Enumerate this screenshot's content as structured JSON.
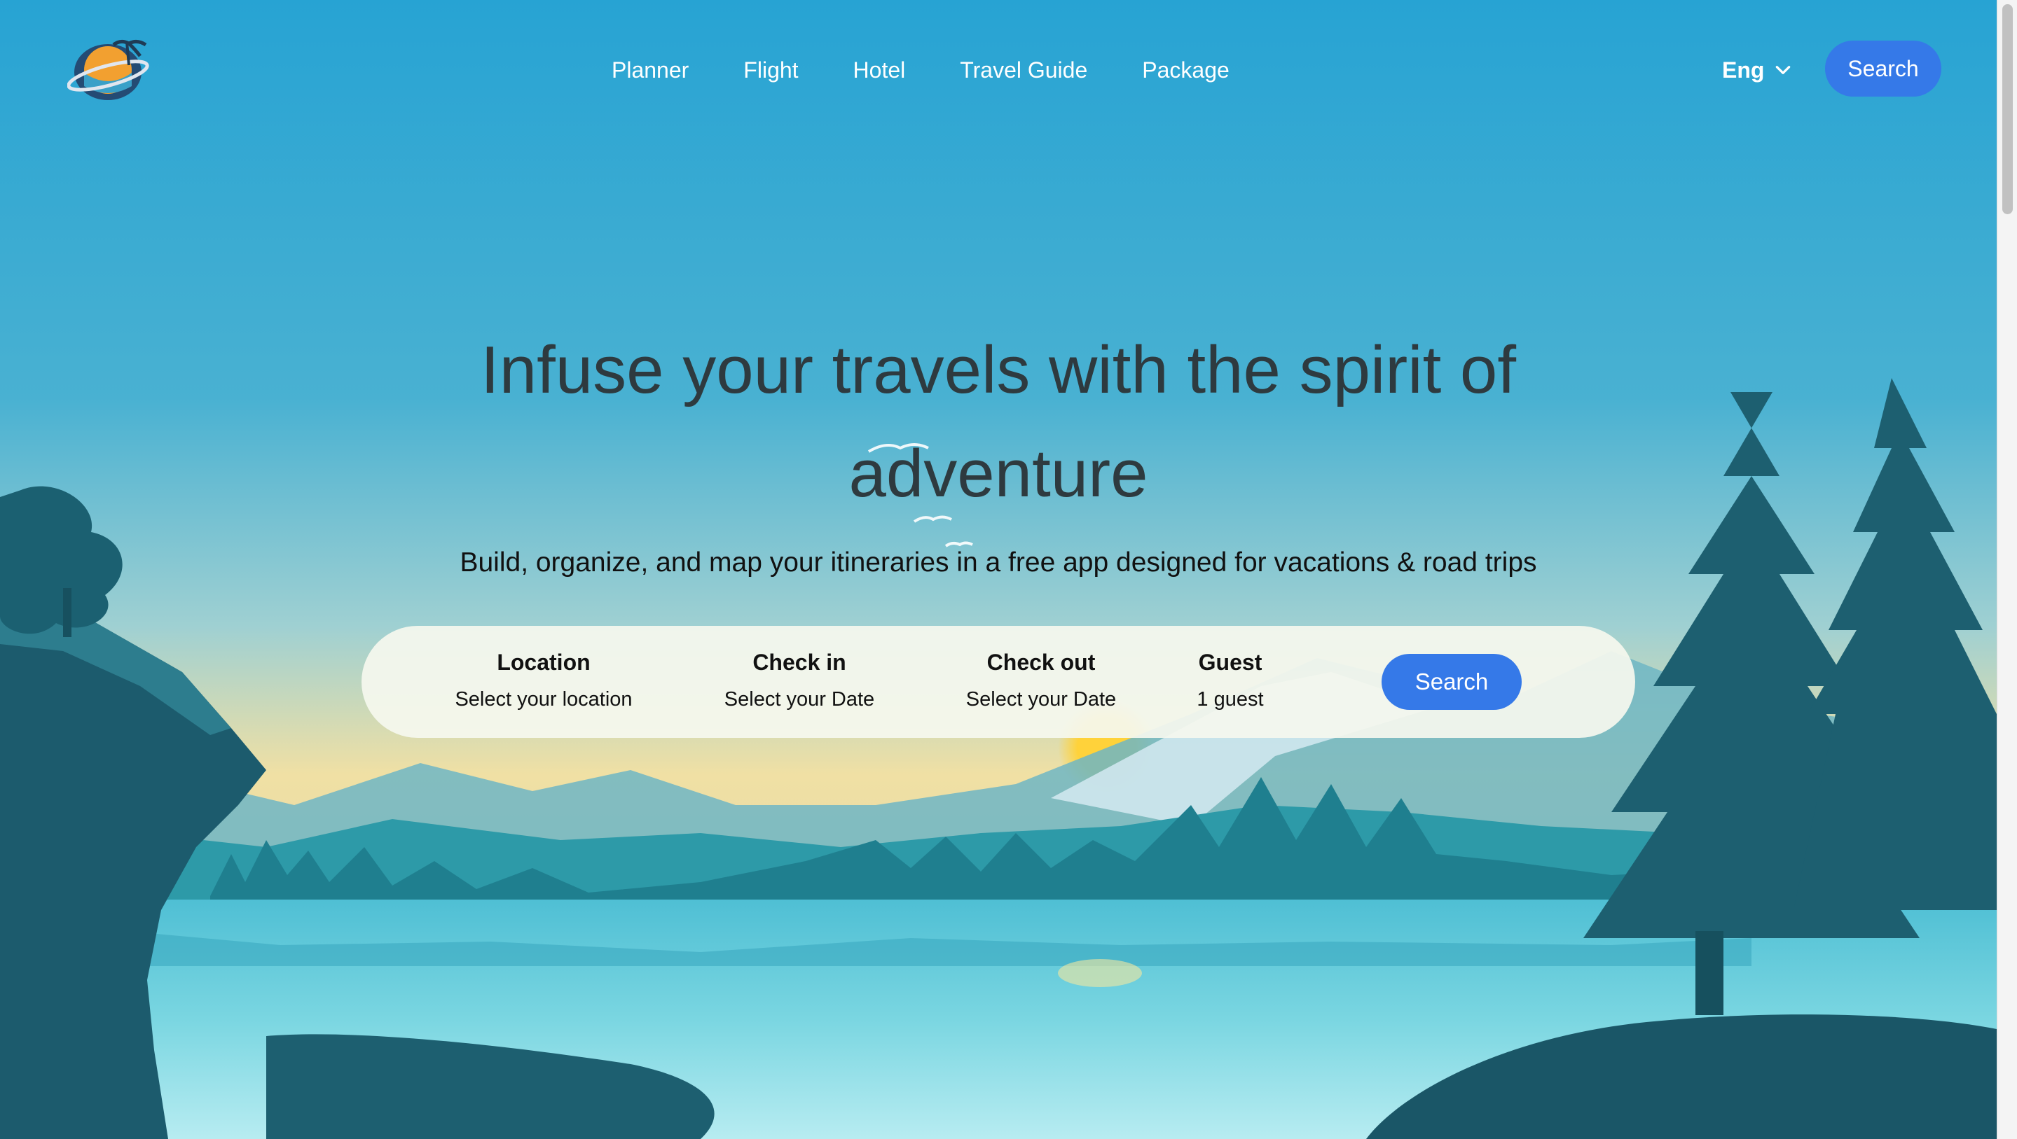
{
  "header": {
    "logo_icon": "palm-island-globe-logo",
    "nav": [
      "Planner",
      "Flight",
      "Hotel",
      "Travel Guide",
      "Package"
    ],
    "language": "Eng",
    "search_label": "Search"
  },
  "hero": {
    "title": "Infuse your travels with the spirit of adventure",
    "subtitle": "Build, organize, and map your itineraries in a free app designed for vacations & road trips"
  },
  "search_bar": {
    "location_label": "Location",
    "location_value": "Select your location",
    "checkin_label": "Check in",
    "checkin_value": "Select your Date",
    "checkout_label": "Check out",
    "checkout_value": "Select your Date",
    "guest_label": "Guest",
    "guest_value": "1 guest",
    "search_label": "Search"
  },
  "colors": {
    "accent": "#3579e8",
    "sky_top": "#27a3d3",
    "sky_horizon": "#f3dfa0",
    "lake": "#62c8d9",
    "trees": "#1d6172"
  }
}
